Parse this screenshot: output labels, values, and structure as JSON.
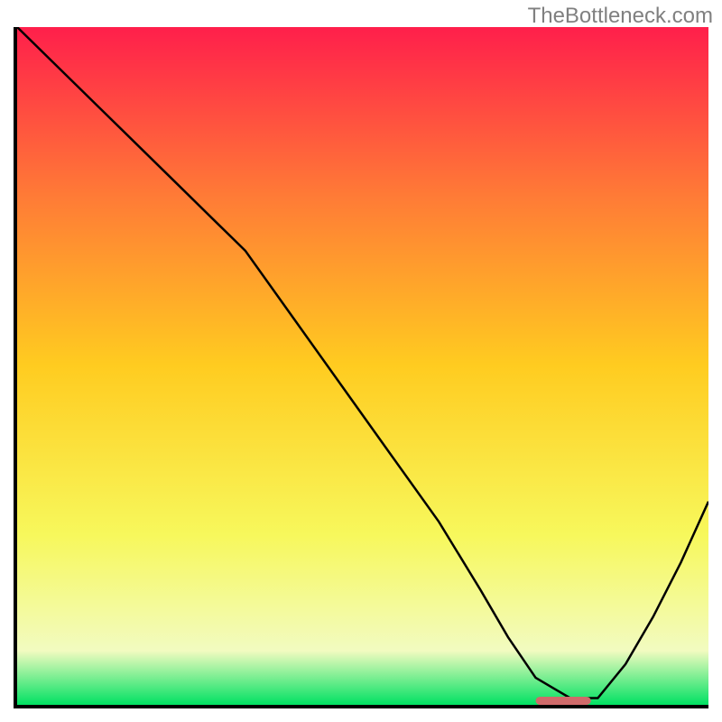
{
  "watermark": "TheBottleneck.com",
  "chart_data": {
    "type": "line",
    "title": "",
    "xlabel": "",
    "ylabel": "",
    "xlim": [
      0,
      100
    ],
    "ylim": [
      0,
      100
    ],
    "grid": false,
    "legend": false,
    "background_gradient": {
      "from_color": "#ff1f4b",
      "to_color": "#01e163",
      "stops": [
        {
          "offset": 0,
          "color": "#ff1f4b"
        },
        {
          "offset": 25,
          "color": "#ff7b36"
        },
        {
          "offset": 50,
          "color": "#ffcc20"
        },
        {
          "offset": 75,
          "color": "#f7f85c"
        },
        {
          "offset": 92,
          "color": "#f2fbc0"
        },
        {
          "offset": 100,
          "color": "#01e163"
        }
      ]
    },
    "series": [
      {
        "name": "bottleneck-curve",
        "color": "#000000",
        "x": [
          0,
          6,
          12,
          18,
          24,
          29,
          33,
          40,
          47,
          54,
          61,
          67,
          71,
          75,
          80,
          84,
          88,
          92,
          96,
          100
        ],
        "y": [
          100,
          94,
          88,
          82,
          76,
          71,
          67,
          57,
          47,
          37,
          27,
          17,
          10,
          4,
          1,
          1,
          6,
          13,
          21,
          30
        ]
      }
    ],
    "marker": {
      "name": "optimal-marker",
      "color": "#cf6a6a",
      "x_center": 79,
      "y": 0.6,
      "width": 8,
      "height": 1.2,
      "shape": "rounded-rect"
    },
    "axes": {
      "color": "#000000",
      "width": 4,
      "show_ticks": false
    }
  }
}
